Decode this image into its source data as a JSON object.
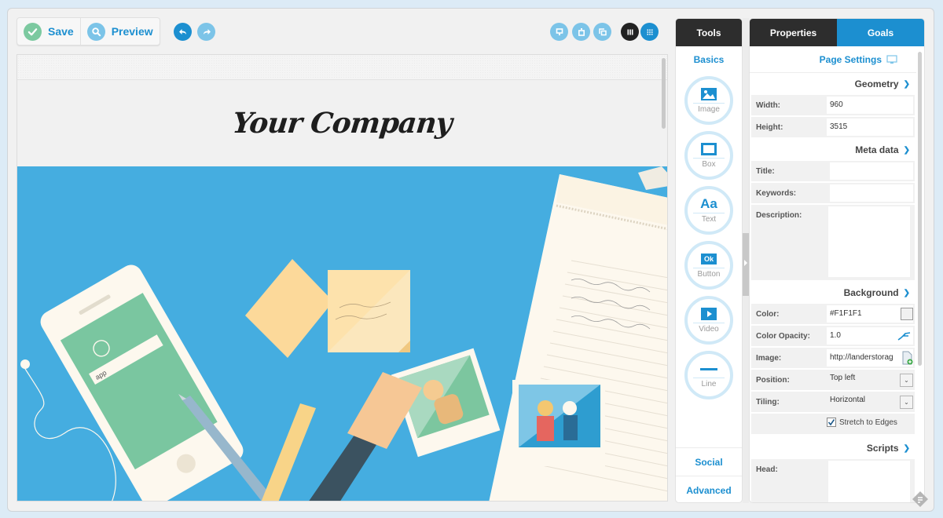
{
  "toolbar": {
    "save_label": "Save",
    "preview_label": "Preview",
    "undo_icon": "undo-arrow-icon",
    "redo_icon": "redo-arrow-icon",
    "view_icons": [
      "desktop-view-icon",
      "mobile-view-icon",
      "layers-icon"
    ],
    "grid_icons": [
      "columns-icon",
      "grid-dots-icon"
    ]
  },
  "canvas": {
    "company_name": "Your Company",
    "hero_search_text": "app"
  },
  "tools": {
    "tab_label": "Tools",
    "section_basics": "Basics",
    "items": [
      {
        "label": "Image",
        "icon": "image-icon"
      },
      {
        "label": "Box",
        "icon": "box-icon"
      },
      {
        "label": "Text",
        "icon": "text-icon",
        "glyph": "Aa"
      },
      {
        "label": "Button",
        "icon": "button-icon",
        "glyph": "Ok"
      },
      {
        "label": "Video",
        "icon": "video-icon"
      },
      {
        "label": "Line",
        "icon": "line-icon"
      }
    ],
    "section_social": "Social",
    "section_advanced": "Advanced"
  },
  "properties": {
    "tabs": [
      {
        "label": "Properties",
        "active": true
      },
      {
        "label": "Goals",
        "active": false
      }
    ],
    "page_settings_label": "Page Settings",
    "geometry": {
      "title": "Geometry",
      "width_label": "Width:",
      "width_value": "960",
      "height_label": "Height:",
      "height_value": "3515"
    },
    "meta": {
      "title": "Meta data",
      "title_label": "Title:",
      "title_value": "",
      "keywords_label": "Keywords:",
      "keywords_value": "",
      "description_label": "Description:",
      "description_value": ""
    },
    "background": {
      "title": "Background",
      "color_label": "Color:",
      "color_value": "#F1F1F1",
      "opacity_label": "Color Opacity:",
      "opacity_value": "1.0",
      "image_label": "Image:",
      "image_value": "http://landerstorag",
      "position_label": "Position:",
      "position_value": "Top left",
      "tiling_label": "Tiling:",
      "tiling_value": "Horizontal",
      "stretch_label": "Stretch to Edges",
      "stretch_checked": true
    },
    "scripts": {
      "title": "Scripts",
      "head_label": "Head:",
      "head_value": ""
    }
  },
  "colors": {
    "accent": "#1c8fd0",
    "accent_light": "#7cc4e8",
    "save_green": "#7cc9a0",
    "tab_dark": "#2d2d2d",
    "hero_blue": "#45ade0"
  }
}
